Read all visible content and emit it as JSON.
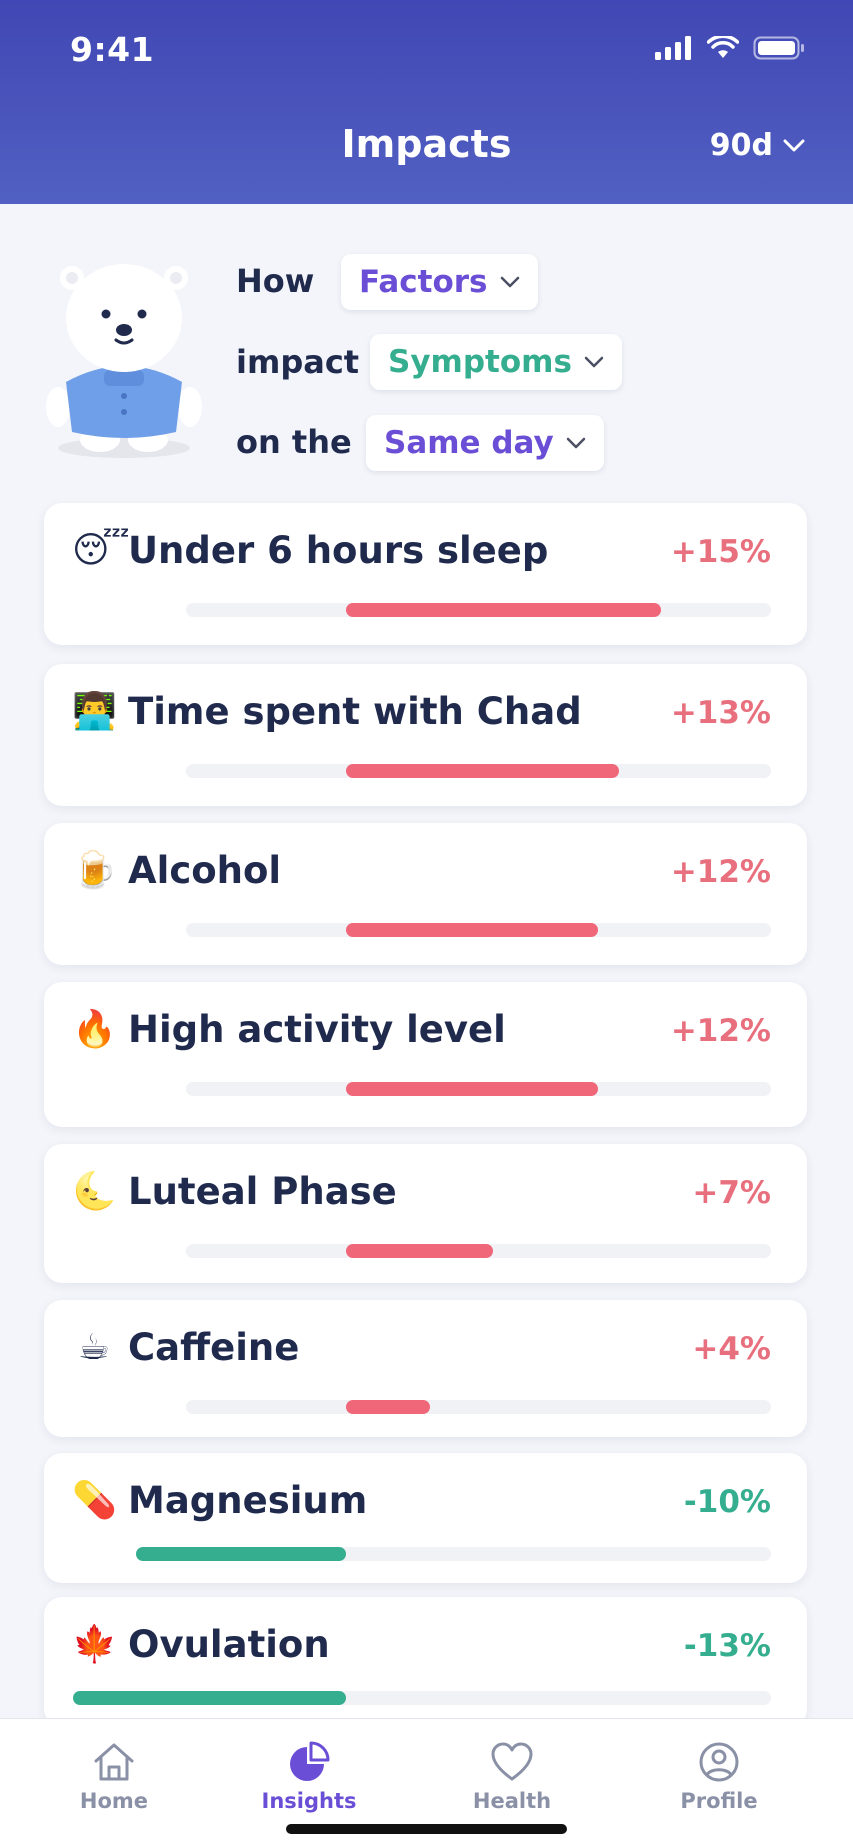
{
  "status_bar": {
    "time": "9:41"
  },
  "header": {
    "title": "Impacts",
    "range": "90d"
  },
  "query": {
    "word1": "How",
    "filter1": "Factors",
    "word2": "impact",
    "filter2": "Symptoms",
    "word3": "on the",
    "filter3": "Same day"
  },
  "colors": {
    "accent": "#6a4fd6",
    "positive": "#f1677a",
    "negative": "#35ad8f",
    "header": "#4147b4"
  },
  "impacts": [
    {
      "emoji": "😴",
      "icon": "sleeping-face-icon",
      "label": "Under 6 hours sleep",
      "percent_text": "+15%",
      "value": 15
    },
    {
      "emoji": "👨‍💻",
      "icon": "person-at-laptop-icon",
      "label": "Time spent with Chad",
      "percent_text": "+13%",
      "value": 13
    },
    {
      "emoji": "🍺",
      "icon": "beer-mug-icon",
      "label": "Alcohol",
      "percent_text": "+12%",
      "value": 12
    },
    {
      "emoji": "🔥",
      "icon": "fire-icon",
      "label": "High activity level",
      "percent_text": "+12%",
      "value": 12
    },
    {
      "emoji": "🌜",
      "icon": "moon-face-icon",
      "label": "Luteal Phase",
      "percent_text": "+7%",
      "value": 7
    },
    {
      "emoji": "☕",
      "icon": "coffee-cup-icon",
      "label": "Caffeine",
      "percent_text": "+4%",
      "value": 4
    },
    {
      "emoji": "💊",
      "icon": "pill-icon",
      "label": "Magnesium",
      "percent_text": "-10%",
      "value": -10
    },
    {
      "emoji": "🍁",
      "icon": "maple-leaf-icon",
      "label": "Ovulation",
      "percent_text": "-13%",
      "value": -13
    }
  ],
  "tabbar": {
    "items": [
      {
        "label": "Home",
        "icon": "home-icon",
        "active": false
      },
      {
        "label": "Insights",
        "icon": "pie-chart-icon",
        "active": true
      },
      {
        "label": "Health",
        "icon": "heart-icon",
        "active": false
      },
      {
        "label": "Profile",
        "icon": "profile-icon",
        "active": false
      }
    ]
  }
}
